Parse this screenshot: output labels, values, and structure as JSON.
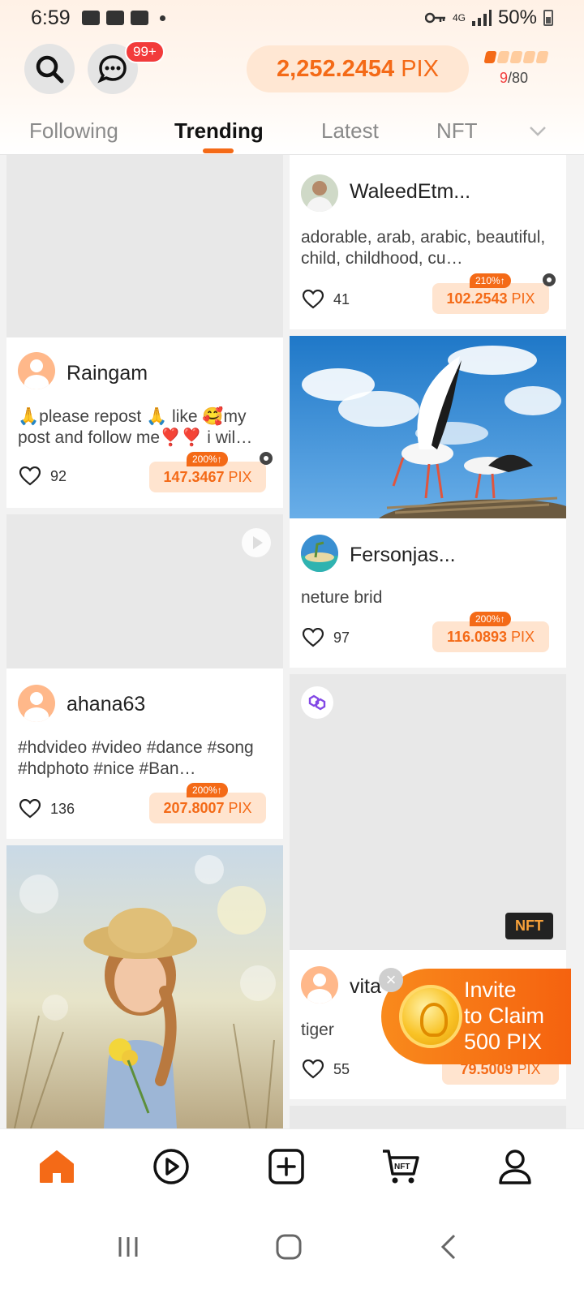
{
  "status_bar": {
    "time": "6:59",
    "network": "4G",
    "battery": "50%"
  },
  "header": {
    "badge": "99+",
    "balance_value": "2,252.2454",
    "balance_unit": "PIX",
    "energy_current": "9",
    "energy_total": "/80"
  },
  "tabs": [
    "Following",
    "Trending",
    "Latest",
    "NFT"
  ],
  "posts": [
    {
      "user": "",
      "desc": "",
      "likes": "",
      "reward": "",
      "unit": "",
      "boost": ""
    },
    {
      "user": "Raingam",
      "desc": "🙏please repost 🙏 like 🥰my post and follow me❣️❣️ i wil…",
      "likes": "92",
      "reward": "147.3467",
      "unit": "PIX",
      "boost": "200%↑"
    },
    {
      "user": "ahana63",
      "desc": "#hdvideo #video #dance #song #hdphoto #nice #Ban…",
      "likes": "136",
      "reward": "207.8007",
      "unit": "PIX",
      "boost": "200%↑"
    },
    {
      "user": "WaleedEtm...",
      "desc": "adorable, arab, arabic, beautiful, child, childhood, cu…",
      "likes": "41",
      "reward": "102.2543",
      "unit": "PIX",
      "boost": "210%↑"
    },
    {
      "user": "Fersonjas...",
      "desc": "neture brid",
      "likes": "97",
      "reward": "116.0893",
      "unit": "PIX",
      "boost": "200%↑"
    },
    {
      "user": "vita",
      "desc": "tiger",
      "likes": "55",
      "reward": "79.5009",
      "unit": "PIX",
      "boost": ""
    }
  ],
  "nft_tag": "NFT",
  "invite": {
    "line1": "Invite",
    "line2": "to Claim",
    "line3": "500 PIX"
  },
  "icons": {
    "search": "search-icon",
    "messages": "chat-icon",
    "home": "home-icon",
    "video": "play-icon",
    "create": "add-icon",
    "nft_market": "nft-cart-icon",
    "profile": "profile-icon"
  },
  "colors": {
    "accent": "#f46a17",
    "badge": "#f23b3b",
    "reward_bg": "#ffe4cf"
  }
}
